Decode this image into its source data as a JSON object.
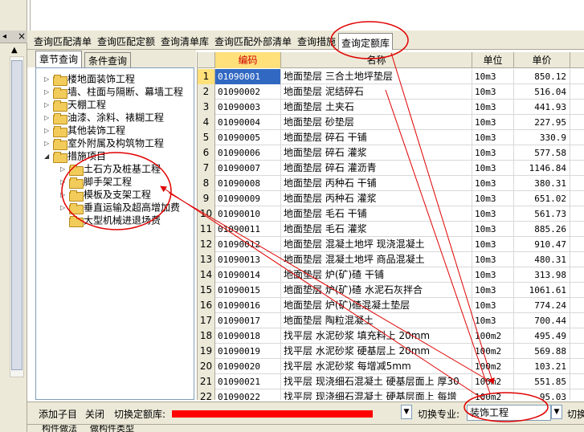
{
  "main_tabs": [
    {
      "label": "查询匹配清单"
    },
    {
      "label": "查询匹配定额"
    },
    {
      "label": "查询清单库"
    },
    {
      "label": "查询匹配外部清单"
    },
    {
      "label": "查询措施"
    },
    {
      "label": "查询定额库",
      "active": true
    }
  ],
  "sub_tabs": [
    {
      "label": "章节查询",
      "active": true
    },
    {
      "label": "条件查询"
    }
  ],
  "tree": [
    {
      "label": "楼地面装饰工程",
      "level": 0,
      "expanded": false
    },
    {
      "label": "墙、柱面与隔断、幕墙工程",
      "level": 0,
      "expanded": false
    },
    {
      "label": "天棚工程",
      "level": 0,
      "expanded": false
    },
    {
      "label": "油漆、涂料、裱糊工程",
      "level": 0,
      "expanded": false
    },
    {
      "label": "其他装饰工程",
      "level": 0,
      "expanded": false
    },
    {
      "label": "室外附属及构筑物工程",
      "level": 0,
      "expanded": false
    },
    {
      "label": "措施项目",
      "level": 0,
      "expanded": true
    },
    {
      "label": "土石方及桩基工程",
      "level": 1,
      "expanded": false
    },
    {
      "label": "脚手架工程",
      "level": 1,
      "expanded": false
    },
    {
      "label": "模板及支架工程",
      "level": 1,
      "expanded": false
    },
    {
      "label": "垂直运输及超高增加费",
      "level": 1,
      "expanded": false
    },
    {
      "label": "大型机械进退场费",
      "level": 1,
      "expanded": false
    }
  ],
  "table": {
    "headers": {
      "code": "编码",
      "name": "名称",
      "unit": "单位",
      "price": "单价"
    },
    "rows": [
      {
        "num": "1",
        "code": "01090001",
        "name": "地面垫层 三合土地坪垫层",
        "unit": "10m3",
        "price": "850.12"
      },
      {
        "num": "2",
        "code": "01090002",
        "name": "地面垫层 泥结碎石",
        "unit": "10m3",
        "price": "516.04"
      },
      {
        "num": "3",
        "code": "01090003",
        "name": "地面垫层 土夹石",
        "unit": "10m3",
        "price": "441.93"
      },
      {
        "num": "4",
        "code": "01090004",
        "name": "地面垫层 砂垫层",
        "unit": "10m3",
        "price": "227.95"
      },
      {
        "num": "5",
        "code": "01090005",
        "name": "地面垫层 碎石 干铺",
        "unit": "10m3",
        "price": "330.9"
      },
      {
        "num": "6",
        "code": "01090006",
        "name": "地面垫层 碎石 灌浆",
        "unit": "10m3",
        "price": "577.58"
      },
      {
        "num": "7",
        "code": "01090007",
        "name": "地面垫层 碎石 灌沥青",
        "unit": "10m3",
        "price": "1146.84"
      },
      {
        "num": "8",
        "code": "01090008",
        "name": "地面垫层 丙种石 干铺",
        "unit": "10m3",
        "price": "380.31"
      },
      {
        "num": "9",
        "code": "01090009",
        "name": "地面垫层 丙种石 灌浆",
        "unit": "10m3",
        "price": "651.02"
      },
      {
        "num": "10",
        "code": "01090010",
        "name": "地面垫层 毛石 干铺",
        "unit": "10m3",
        "price": "561.73"
      },
      {
        "num": "11",
        "code": "01090011",
        "name": "地面垫层 毛石 灌浆",
        "unit": "10m3",
        "price": "885.26"
      },
      {
        "num": "12",
        "code": "01090012",
        "name": "地面垫层 混凝土地坪 现浇混凝土",
        "unit": "10m3",
        "price": "910.47"
      },
      {
        "num": "13",
        "code": "01090013",
        "name": "地面垫层 混凝土地坪 商品混凝土",
        "unit": "10m3",
        "price": "480.31"
      },
      {
        "num": "14",
        "code": "01090014",
        "name": "地面垫层 炉(矿)碴 干铺",
        "unit": "10m3",
        "price": "313.98"
      },
      {
        "num": "15",
        "code": "01090015",
        "name": "地面垫层 炉(矿)碴 水泥石灰拌合",
        "unit": "10m3",
        "price": "1061.61"
      },
      {
        "num": "16",
        "code": "01090016",
        "name": "地面垫层 炉(矿)碴混凝土垫层",
        "unit": "10m3",
        "price": "774.24"
      },
      {
        "num": "17",
        "code": "01090017",
        "name": "地面垫层 陶粒混凝土",
        "unit": "10m3",
        "price": "700.44"
      },
      {
        "num": "18",
        "code": "01090018",
        "name": "找平层 水泥砂浆 填充料上 20mm",
        "unit": "100m2",
        "price": "495.49"
      },
      {
        "num": "19",
        "code": "01090019",
        "name": "找平层 水泥砂浆 硬基层上 20mm",
        "unit": "100m2",
        "price": "569.88"
      },
      {
        "num": "20",
        "code": "01090020",
        "name": "找平层 水泥砂浆 每增减5mm",
        "unit": "100m2",
        "price": "103.21"
      },
      {
        "num": "21",
        "code": "01090021",
        "name": "找平层 现浇细石混凝土 硬基层面上 厚30",
        "unit": "100m2",
        "price": "551.85"
      },
      {
        "num": "22",
        "code": "01090022",
        "name": "找平层 现浇细石混凝土 硬基层面上 每增",
        "unit": "100m2",
        "price": "95.03"
      }
    ]
  },
  "bottom": {
    "add_child": "添加子目",
    "close": "关闭",
    "switch_lib_label": "切换定额库:",
    "switch_major_label": "切换专业:",
    "major_value": "装饰工程",
    "switch_more": "切换"
  },
  "status": {
    "tab1": "构件做法",
    "tab2": "做构件类型"
  }
}
